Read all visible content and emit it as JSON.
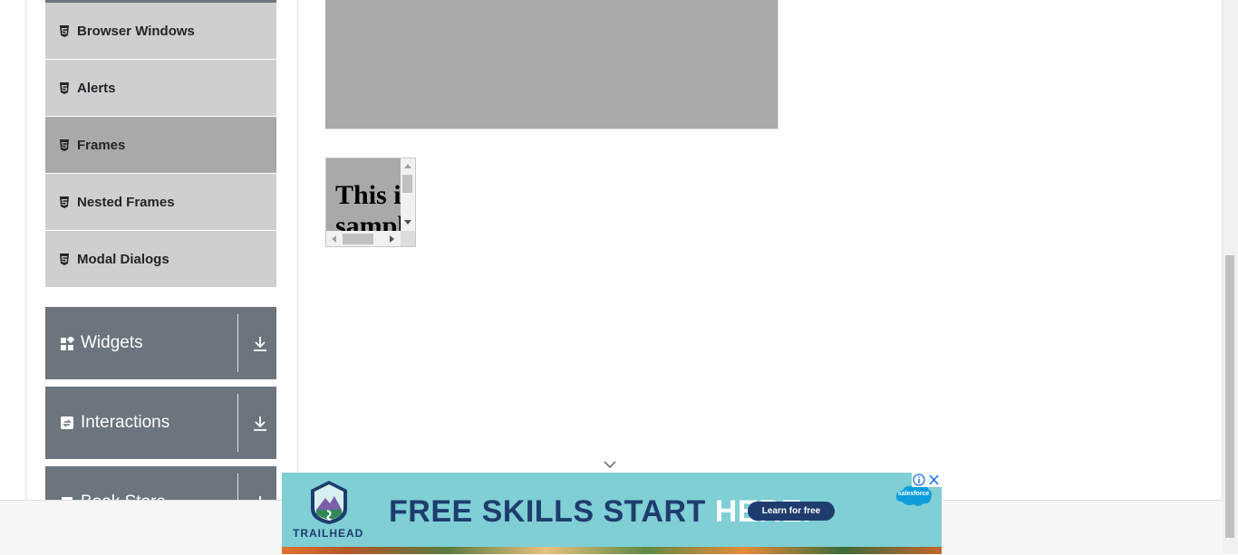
{
  "sidebar": {
    "items": [
      {
        "label": "Browser Windows",
        "active": false
      },
      {
        "label": "Alerts",
        "active": false
      },
      {
        "label": "Frames",
        "active": true
      },
      {
        "label": "Nested Frames",
        "active": false
      },
      {
        "label": "Modal Dialogs",
        "active": false
      }
    ],
    "groups": [
      {
        "label": "Widgets",
        "icon": "widgets-icon"
      },
      {
        "label": "Interactions",
        "icon": "interactions-icon"
      },
      {
        "label": "Book Store",
        "icon": "book-store-icon"
      }
    ]
  },
  "frames": {
    "small_text": "This is a sample page"
  },
  "ad": {
    "brand": "TRAILHEAD",
    "headline_main": "FREE SKILLS START ",
    "headline_highlight": "HERE.",
    "cta": "Learn for free",
    "sponsor": "salesforce"
  },
  "colors": {
    "menu_item_bg": "#cfcfcf",
    "menu_item_active_bg": "#a9a9a9",
    "group_bg": "#6c757d",
    "frame_bg": "#a9a9a9",
    "ad_bg": "#7fcfd5",
    "ad_text": "#1f3c6e"
  }
}
